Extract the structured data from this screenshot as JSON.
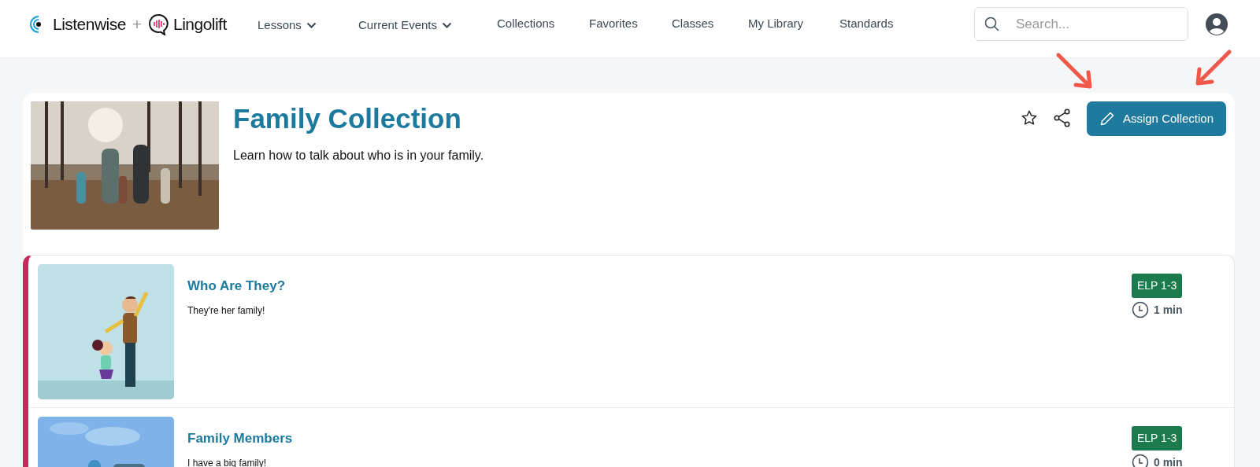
{
  "brand": {
    "name": "Listenwise",
    "separator": "+",
    "partner": "Lingolift"
  },
  "nav": [
    {
      "label": "Lessons",
      "dropdown": true
    },
    {
      "label": "Current Events",
      "dropdown": true
    },
    {
      "label": "Collections",
      "dropdown": false
    },
    {
      "label": "Favorites",
      "dropdown": false
    },
    {
      "label": "Classes",
      "dropdown": false
    },
    {
      "label": "My Library",
      "dropdown": false
    },
    {
      "label": "Standards",
      "dropdown": false
    }
  ],
  "search": {
    "placeholder": "Search..."
  },
  "collection": {
    "title": "Family Collection",
    "description": "Learn how to talk about who is in your family.",
    "assign_button": "Assign Collection"
  },
  "lessons": [
    {
      "title": "Who Are They?",
      "subtitle": "They're her family!",
      "badge": "ELP 1-3",
      "duration": "1 min"
    },
    {
      "title": "Family Members",
      "subtitle": "I have a big family!",
      "badge": "ELP 1-3",
      "duration": "0 min"
    }
  ],
  "annotations": [
    {
      "kind": "arrow"
    },
    {
      "kind": "arrow"
    }
  ]
}
